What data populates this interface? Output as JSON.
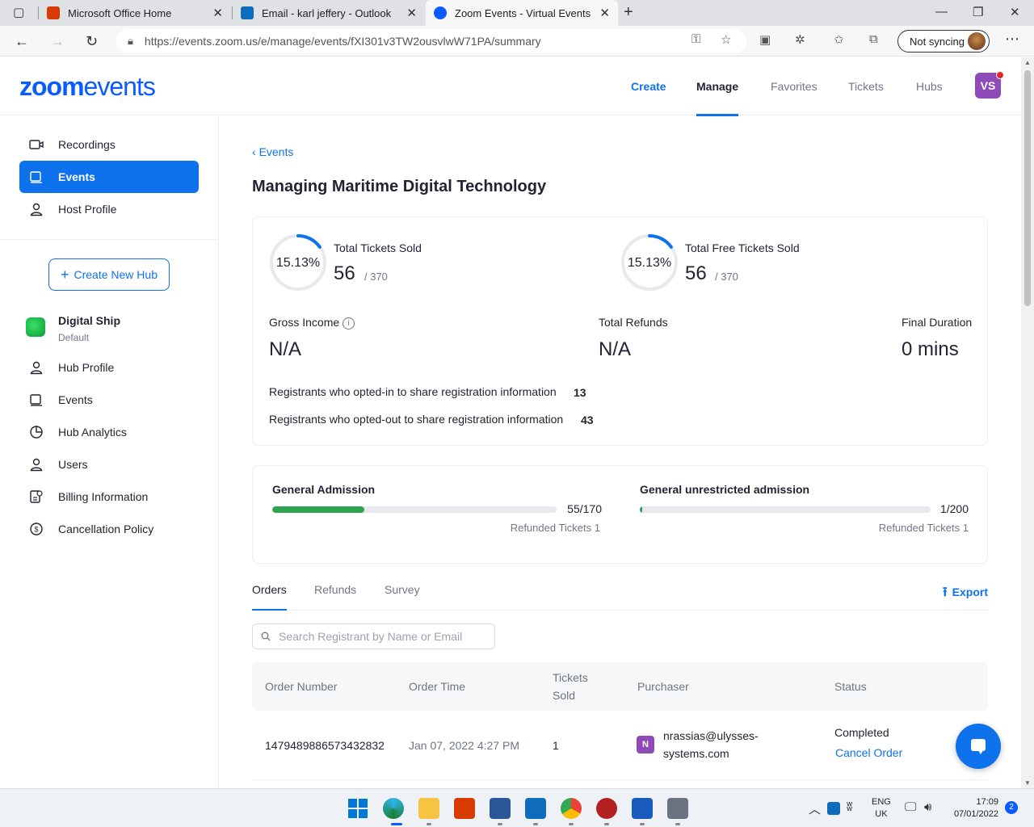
{
  "browser": {
    "tabs": [
      {
        "title": "Microsoft Office Home",
        "favicon": "office-icon",
        "color": "#d83b01"
      },
      {
        "title": "Email - karl jeffery - Outlook",
        "favicon": "outlook-icon",
        "color": "#0f6cbd"
      },
      {
        "title": "Zoom Events - Virtual Events Plat",
        "favicon": "zoom-icon",
        "color": "#0b5cff"
      }
    ],
    "url": "https://events.zoom.us/e/manage/events/fXI301v3TW2ousvlwW71PA/summary",
    "sync_label": "Not syncing"
  },
  "header": {
    "logo_bold": "zoom",
    "logo_light": "events",
    "nav": [
      "Create",
      "Manage",
      "Favorites",
      "Tickets",
      "Hubs"
    ],
    "avatar_initials": "VS",
    "avatar_color": "#8e4bb8"
  },
  "sidebar": {
    "top_items": [
      {
        "label": "Recordings",
        "icon": "video-icon"
      },
      {
        "label": "Events",
        "icon": "events-icon"
      },
      {
        "label": "Host Profile",
        "icon": "user-icon"
      }
    ],
    "create_hub_label": "Create New Hub",
    "hub": {
      "name": "Digital Ship",
      "subtitle": "Default"
    },
    "hub_items": [
      {
        "label": "Hub Profile",
        "icon": "user-icon"
      },
      {
        "label": "Events",
        "icon": "events-icon"
      },
      {
        "label": "Hub Analytics",
        "icon": "analytics-icon"
      },
      {
        "label": "Users",
        "icon": "user-icon"
      },
      {
        "label": "Billing Information",
        "icon": "billing-icon"
      },
      {
        "label": "Cancellation Policy",
        "icon": "policy-icon"
      }
    ]
  },
  "main": {
    "back_label": "Events",
    "title": "Managing Maritime Digital Technology",
    "tickets": [
      {
        "percent_label": "15.13%",
        "percent": 15.13,
        "label": "Total Tickets Sold",
        "sold": "56",
        "total": "/ 370"
      },
      {
        "percent_label": "15.13%",
        "percent": 15.13,
        "label": "Total Free Tickets Sold",
        "sold": "56",
        "total": "/ 370"
      }
    ],
    "metrics": [
      {
        "label": "Gross Income",
        "value": "N/A"
      },
      {
        "label": "Total Refunds",
        "value": "N/A"
      },
      {
        "label": "Final Duration",
        "value": "0 mins"
      }
    ],
    "opted_in": {
      "label": "Registrants who opted-in to share registration information",
      "value": "13"
    },
    "opted_out": {
      "label": "Registrants who opted-out to share registration information",
      "value": "43"
    },
    "admissions": [
      {
        "name": "General Admission",
        "count": "55/170",
        "fraction": 0.3235,
        "refunded": "Refunded Tickets 1"
      },
      {
        "name": "General unrestricted admission",
        "count": "1/200",
        "fraction": 0.005,
        "refunded": "Refunded Tickets 1"
      }
    ],
    "subtabs": [
      "Orders",
      "Refunds",
      "Survey"
    ],
    "export_label": "Export",
    "search_placeholder": "Search Registrant by Name or Email",
    "table": {
      "headers": [
        "Order Number",
        "Order Time",
        "Tickets Sold",
        "Purchaser",
        "Status"
      ],
      "rows": [
        {
          "order_number": "1479489886573432832",
          "order_time": "Jan 07, 2022 4:27 PM",
          "tickets": "1",
          "purchaser_initial": "N",
          "purchaser_line1": "nrassias@ulysses-",
          "purchaser_line2": "systems.com",
          "status": "Completed",
          "action": "Cancel Order"
        }
      ]
    }
  },
  "taskbar": {
    "lang_top": "ENG",
    "lang_bottom": "UK",
    "time": "17:09",
    "date": "07/01/2022",
    "notifications": "2"
  }
}
